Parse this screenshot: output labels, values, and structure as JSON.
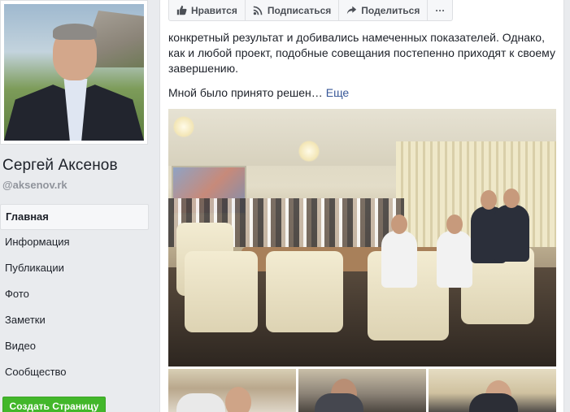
{
  "profile": {
    "name": "Сергей Аксенов",
    "handle": "@aksenov.rk"
  },
  "nav": {
    "items": [
      {
        "label": "Главная",
        "active": true
      },
      {
        "label": "Информация"
      },
      {
        "label": "Публикации"
      },
      {
        "label": "Фото"
      },
      {
        "label": "Заметки"
      },
      {
        "label": "Видео"
      },
      {
        "label": "Сообщество"
      }
    ],
    "create_page": "Создать Страницу"
  },
  "actions": {
    "like": "Нравится",
    "subscribe": "Подписаться",
    "share": "Поделиться",
    "more": "···"
  },
  "post": {
    "text": "конкретный результат и добивались намеченных показателей. Однако, как и любой проект, подобные совещания постепенно приходят к своему завершению.",
    "truncated": "Мной было принято решен…",
    "more_link": "Еще"
  },
  "colors": {
    "link": "#385898",
    "create_button": "#42b72a",
    "background": "#e9ebee"
  }
}
